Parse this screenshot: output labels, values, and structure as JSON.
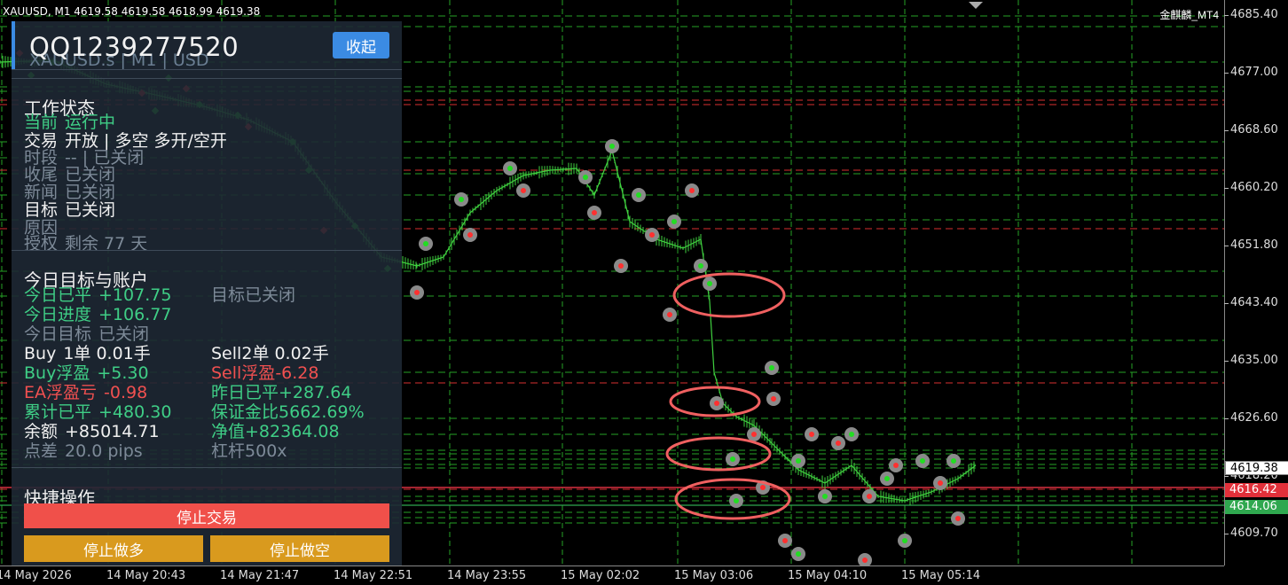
{
  "chart": {
    "title_bar": "XAUUSD, M1  4619.58 4619.58 4618.99 4619.38",
    "brand": "金麒麟_MT4",
    "price_ticks": [
      "4685.40",
      "4677.00",
      "4668.60",
      "4660.20",
      "4651.80",
      "4643.40",
      "4635.00",
      "4626.60",
      "4618.20",
      "4609.70"
    ],
    "time_labels": [
      "14 May 2026",
      "14 May 20:43",
      "14 May 21:47",
      "14 May 22:51",
      "14 May 23:55",
      "15 May 02:02",
      "15 May 03:06",
      "15 May 04:10",
      "15 May 05:14"
    ],
    "price_tags": {
      "current": {
        "value": "4619.38",
        "color": "#ffffff"
      },
      "red": {
        "value": "4616.42",
        "color": "#e2303a"
      },
      "green": {
        "value": "4614.06",
        "color": "#2fa84f"
      }
    },
    "colors": {
      "background": "#000000",
      "candle": "#3fd13f",
      "grid": "#26a226",
      "red_level": "#d93030",
      "annotation_circle": "#f06060"
    },
    "price_range": [
      4607.5,
      4688.0
    ]
  },
  "panel": {
    "account": "QQ1239277520",
    "symbol_line": "XAUUSD.s | M1 | USD",
    "collapse_label": "收起",
    "status": {
      "title": "工作状态",
      "current_label": "当前",
      "current_value": "运行中",
      "trade_label": "交易",
      "trade_value": "开放 | 多空  多开/空开",
      "session_label": "时段",
      "session_value": "-- | 已关闭",
      "close_label": "收尾",
      "close_value": "已关闭",
      "news_label": "新闻",
      "news_value": "已关闭",
      "target_label": "目标",
      "target_value": "已关闭",
      "reason_label": "原因",
      "reason_value": "",
      "license_label": "授权",
      "license_value": "剩余 77 天"
    },
    "today": {
      "title": "今日目标与账户",
      "closed_label": "今日已平",
      "closed_value": "+107.75",
      "target_label": "目标",
      "target_value": "已关闭",
      "progress_label": "今日进度",
      "progress_value": "+106.77",
      "today_target_label": "今日目标",
      "today_target_value": "已关闭",
      "buy_label": "Buy",
      "buy_value": "1单  0.01手",
      "sell_label": "Sell",
      "sell_value": "2单  0.02手",
      "buy_float_label": "Buy浮盈",
      "buy_float_value": "+5.30",
      "sell_float_label": "Sell浮盈",
      "sell_float_value": "-6.28",
      "ea_float_label": "EA浮盈亏",
      "ea_float_value": "-0.98",
      "yesterday_label": "昨日已平",
      "yesterday_value": "+287.64",
      "total_label": "累计已平",
      "total_value": "+480.30",
      "margin_label": "保证金比",
      "margin_value": "5662.69%",
      "balance_label": "余额",
      "balance_value": "+85014.71",
      "equity_label": "净值",
      "equity_value": "+82364.08",
      "spread_label": "点差",
      "spread_value": "20.0 pips",
      "leverage_label": "杠杆",
      "leverage_value": "500x"
    },
    "quick": {
      "title": "快捷操作",
      "stop_trade": "停止交易",
      "stop_long": "停止做多",
      "stop_short": "停止做空"
    }
  }
}
